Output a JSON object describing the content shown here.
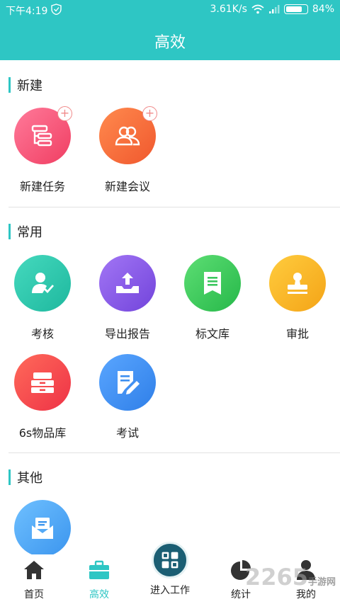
{
  "status_bar": {
    "time": "下午4:19",
    "network_speed": "3.61K/s",
    "battery": "84%",
    "battery_level": 0.84
  },
  "header": {
    "title": "高效"
  },
  "sections": {
    "new": {
      "title": "新建",
      "items": [
        {
          "label": "新建任务",
          "icon": "task-tree-icon",
          "color": "#f5527a"
        },
        {
          "label": "新建会议",
          "icon": "meeting-people-icon",
          "color": "#f66a3e"
        }
      ]
    },
    "common": {
      "title": "常用",
      "items": [
        {
          "label": "考核",
          "icon": "user-check-icon",
          "color": "#2fc9b1"
        },
        {
          "label": "导出报告",
          "icon": "export-tray-icon",
          "color": "#8a5ce8"
        },
        {
          "label": "标文库",
          "icon": "document-library-icon",
          "color": "#3cc75e"
        },
        {
          "label": "审批",
          "icon": "stamp-icon",
          "color": "#f8b628"
        },
        {
          "label": "6s物品库",
          "icon": "storage-drawer-icon",
          "color": "#f4484d"
        },
        {
          "label": "考试",
          "icon": "exam-pencil-icon",
          "color": "#3d8ff0"
        }
      ]
    },
    "other": {
      "title": "其他",
      "items": [
        {
          "label": "",
          "icon": "mail-envelope-icon",
          "color": "#4aa9f5"
        }
      ]
    }
  },
  "bottom_nav": {
    "items": [
      {
        "label": "首页",
        "icon": "home-icon",
        "active": false
      },
      {
        "label": "高效",
        "icon": "briefcase-icon",
        "active": true
      },
      {
        "label": "进入工作",
        "icon": "enter-work-icon",
        "active": false
      },
      {
        "label": "统计",
        "icon": "pie-chart-icon",
        "active": false
      },
      {
        "label": "我的",
        "icon": "profile-icon",
        "active": false
      }
    ]
  },
  "watermark": {
    "text": "2265",
    "sub": "手游网"
  },
  "colors": {
    "accent": "#2ec6c4",
    "active_nav": "#2ec6c4"
  }
}
